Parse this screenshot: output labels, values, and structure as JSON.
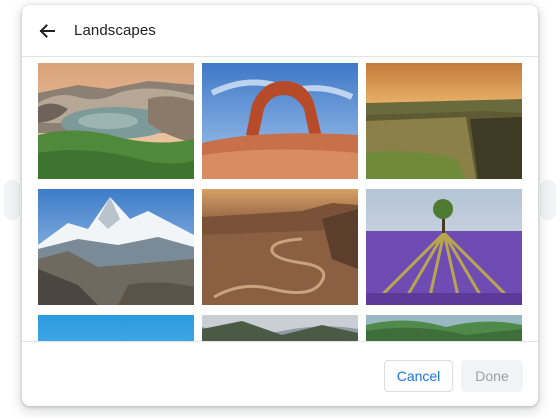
{
  "header": {
    "title": "Landscapes"
  },
  "icons": {
    "back": "arrow-back-icon"
  },
  "footer": {
    "cancel_label": "Cancel",
    "done_label": "Done"
  },
  "colors": {
    "accent": "#1a73e8",
    "disabled_text": "#9aa0a6",
    "disabled_bg": "#f1f3f4"
  },
  "tiles": [
    "coastal-rocks-pool",
    "red-rock-arch",
    "cliffs-at-sunset",
    "snowy-mountain-peak",
    "canyon-winding-road",
    "lavender-field-tree",
    "blue-sky",
    "cloudy-hills",
    "green-valley"
  ]
}
